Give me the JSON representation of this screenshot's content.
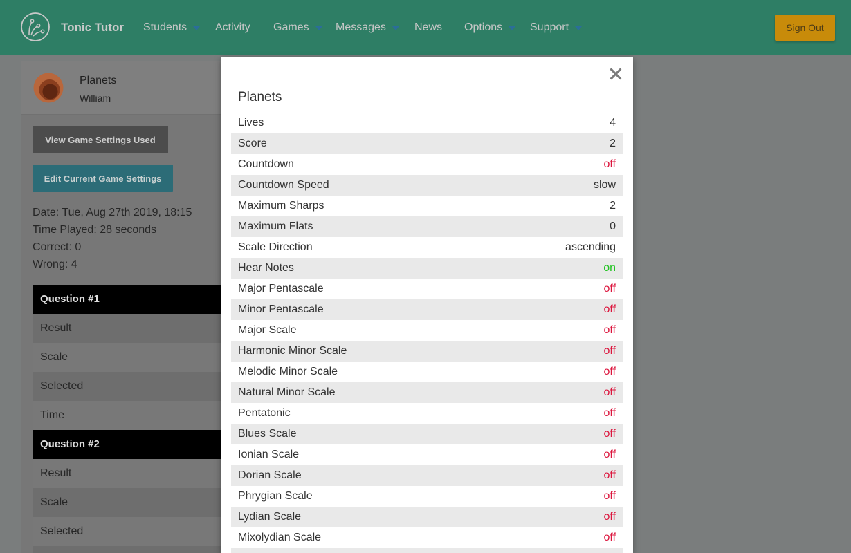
{
  "app": {
    "brand": "Tonic Tutor"
  },
  "nav": {
    "items": [
      {
        "label": "Students",
        "has_dropdown": true
      },
      {
        "label": "Activity",
        "has_dropdown": false
      },
      {
        "label": "Games",
        "has_dropdown": true
      },
      {
        "label": "Messages",
        "has_dropdown": true
      },
      {
        "label": "News",
        "has_dropdown": false
      },
      {
        "label": "Options",
        "has_dropdown": true
      },
      {
        "label": "Support",
        "has_dropdown": true
      }
    ],
    "sign_out_label": "Sign Out"
  },
  "session": {
    "game_name": "Planets",
    "student_name": "William",
    "view_settings_label": "View Game Settings Used",
    "edit_settings_label": "Edit Current Game Settings",
    "date": {
      "label": "Date:",
      "value": "Tue, Aug 27th 2019, 18:15"
    },
    "time_played": {
      "label": "Time Played:",
      "value": "28 seconds"
    },
    "correct": {
      "label": "Correct:",
      "value": "0"
    },
    "wrong": {
      "label": "Wrong:",
      "value": "4"
    }
  },
  "questions": [
    {
      "title": "Question #1",
      "rows": [
        "Result",
        "Scale",
        "Selected",
        "Time"
      ]
    },
    {
      "title": "Question #2",
      "rows": [
        "Result",
        "Scale",
        "Selected"
      ]
    }
  ],
  "modal": {
    "title": "Planets",
    "settings": [
      {
        "label": "Lives",
        "value": "4"
      },
      {
        "label": "Score",
        "value": "2"
      },
      {
        "label": "Countdown",
        "value": "off"
      },
      {
        "label": "Countdown Speed",
        "value": "slow"
      },
      {
        "label": "Maximum Sharps",
        "value": "2"
      },
      {
        "label": "Maximum Flats",
        "value": "0"
      },
      {
        "label": "Scale Direction",
        "value": "ascending"
      },
      {
        "label": "Hear Notes",
        "value": "on"
      },
      {
        "label": "Major Pentascale",
        "value": "off"
      },
      {
        "label": "Minor Pentascale",
        "value": "off"
      },
      {
        "label": "Major Scale",
        "value": "off"
      },
      {
        "label": "Harmonic Minor Scale",
        "value": "off"
      },
      {
        "label": "Melodic Minor Scale",
        "value": "off"
      },
      {
        "label": "Natural Minor Scale",
        "value": "off"
      },
      {
        "label": "Pentatonic",
        "value": "off"
      },
      {
        "label": "Blues Scale",
        "value": "off"
      },
      {
        "label": "Ionian Scale",
        "value": "off"
      },
      {
        "label": "Dorian Scale",
        "value": "off"
      },
      {
        "label": "Phrygian Scale",
        "value": "off"
      },
      {
        "label": "Lydian Scale",
        "value": "off"
      },
      {
        "label": "Mixolydian Scale",
        "value": "off"
      }
    ]
  },
  "icons": {
    "logo": "tonic-tutor-logo-icon",
    "avatar": "planets-game-icon",
    "dropdown": "caret-down-icon",
    "close": "close-icon"
  },
  "colors": {
    "navbar": "#2e7e65",
    "sign_out": "#c88b0a",
    "view_button": "#4c4c4c",
    "edit_button": "#2c6c77",
    "dropdown_caret": "#2b6e99",
    "value_off": "#dc143c",
    "value_on": "#22c322",
    "row_stripe": "#e9e9e9"
  }
}
